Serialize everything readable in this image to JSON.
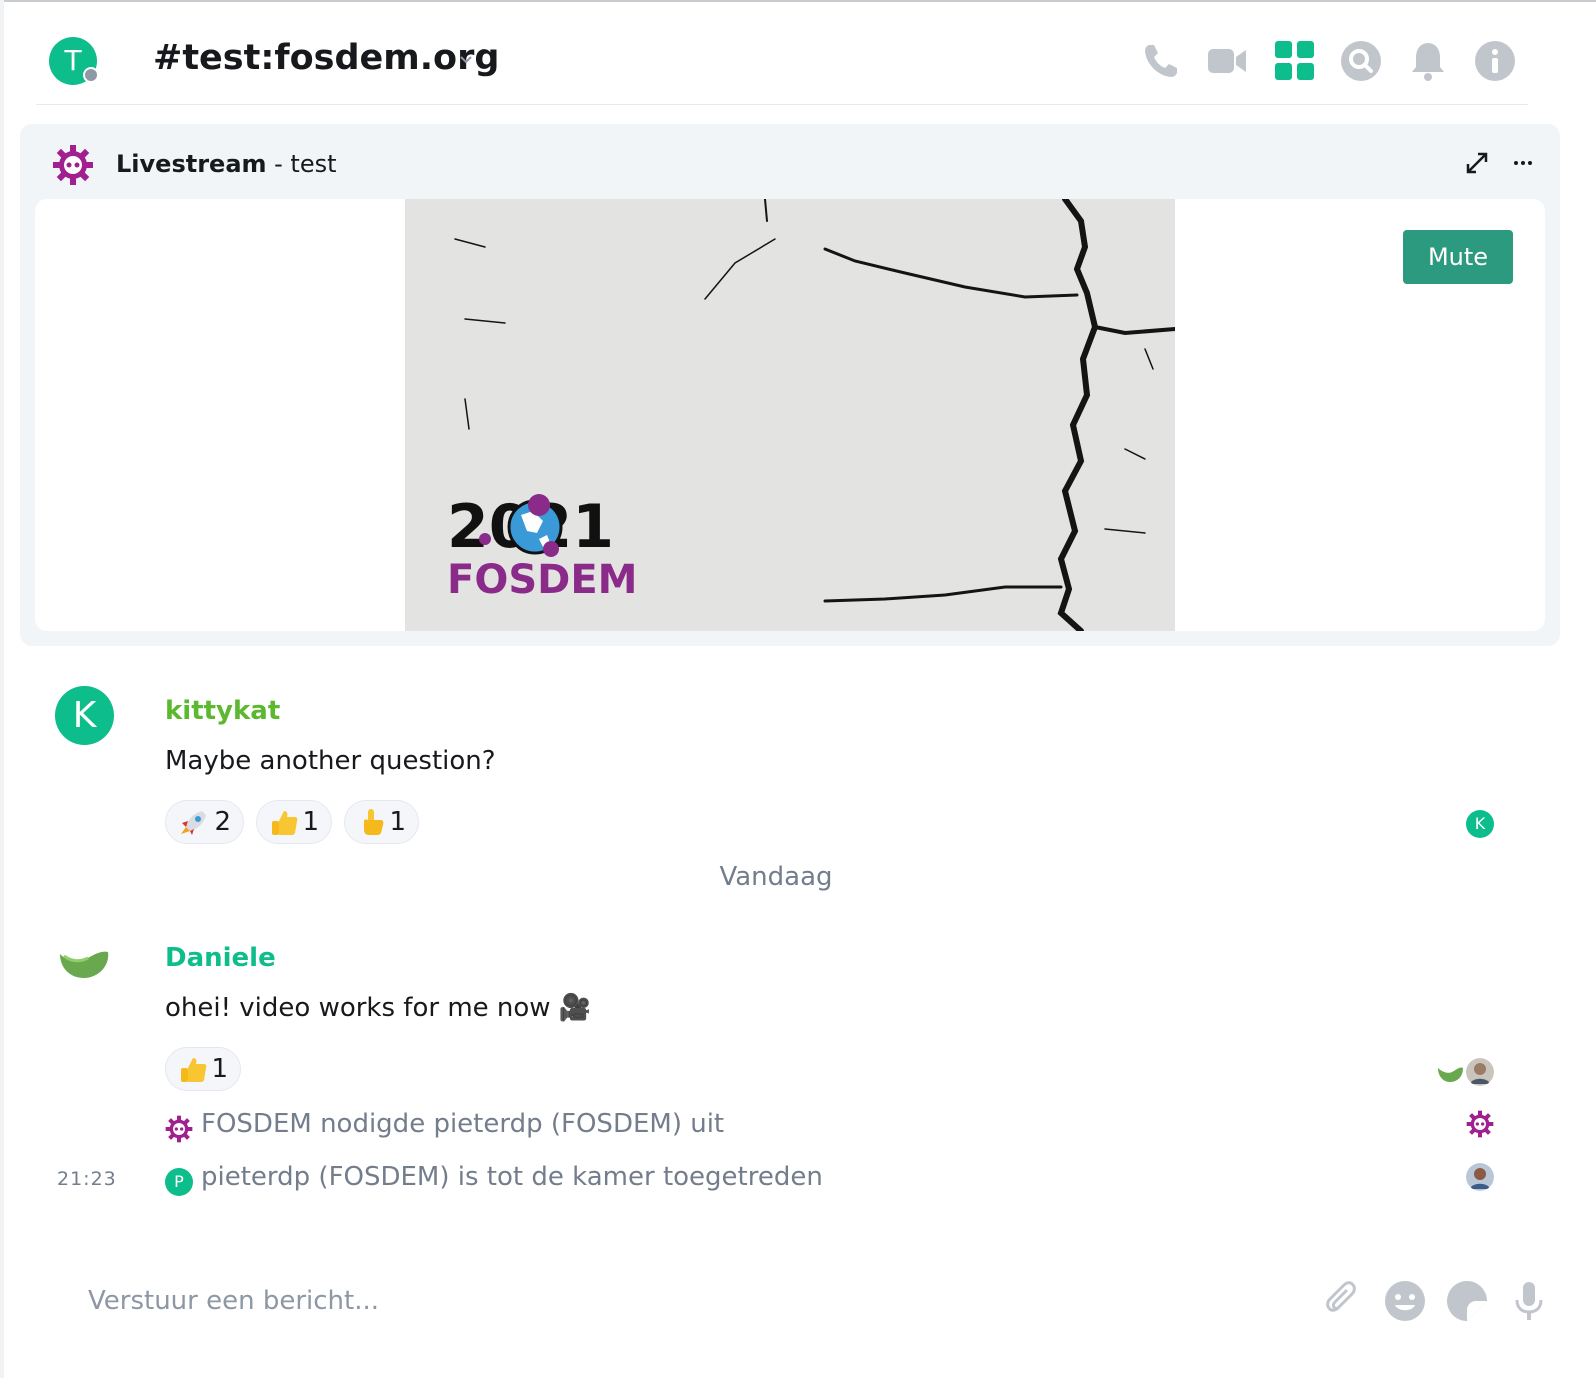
{
  "room": {
    "avatar_letter": "T",
    "name": "#test:fosdem.org"
  },
  "header_icons": [
    "phone-icon",
    "video-call-icon",
    "apps-grid-icon",
    "search-icon",
    "bell-icon",
    "info-icon"
  ],
  "widget": {
    "name": "Livestream",
    "subtitle": " - test",
    "mute_label": "Mute",
    "video_logo_year": "2021",
    "video_logo_text": "FOSDEM"
  },
  "messages": [
    {
      "avatar_letter": "K",
      "sender": "kittykat",
      "sender_color": "#5cb82e",
      "body": "Maybe another question?",
      "reactions": [
        {
          "emoji": "rocket",
          "count": "2"
        },
        {
          "emoji": "thumbs-up",
          "count": "1"
        },
        {
          "emoji": "point-up",
          "count": "1"
        }
      ],
      "read_receipt_letter": "K"
    },
    {
      "sender": "Daniele",
      "sender_color": "#0dbd8b",
      "body": "ohei! video works for me now 🎥",
      "reactions": [
        {
          "emoji": "thumbs-up",
          "count": "1"
        }
      ]
    }
  ],
  "date_separator": "Vandaag",
  "events": [
    {
      "text": "FOSDEM nodigde pieterdp (FOSDEM) uit"
    },
    {
      "avatar_letter": "P",
      "text": "pieterdp (FOSDEM) is tot de kamer toegetreden",
      "timestamp": "21:23"
    }
  ],
  "composer": {
    "placeholder": "Verstuur een bericht..."
  },
  "colors": {
    "accent": "#0dbd8b",
    "fosdem_purple": "#a0208f",
    "mute_button": "#2c9a7e",
    "muted_text": "#737d8c"
  }
}
